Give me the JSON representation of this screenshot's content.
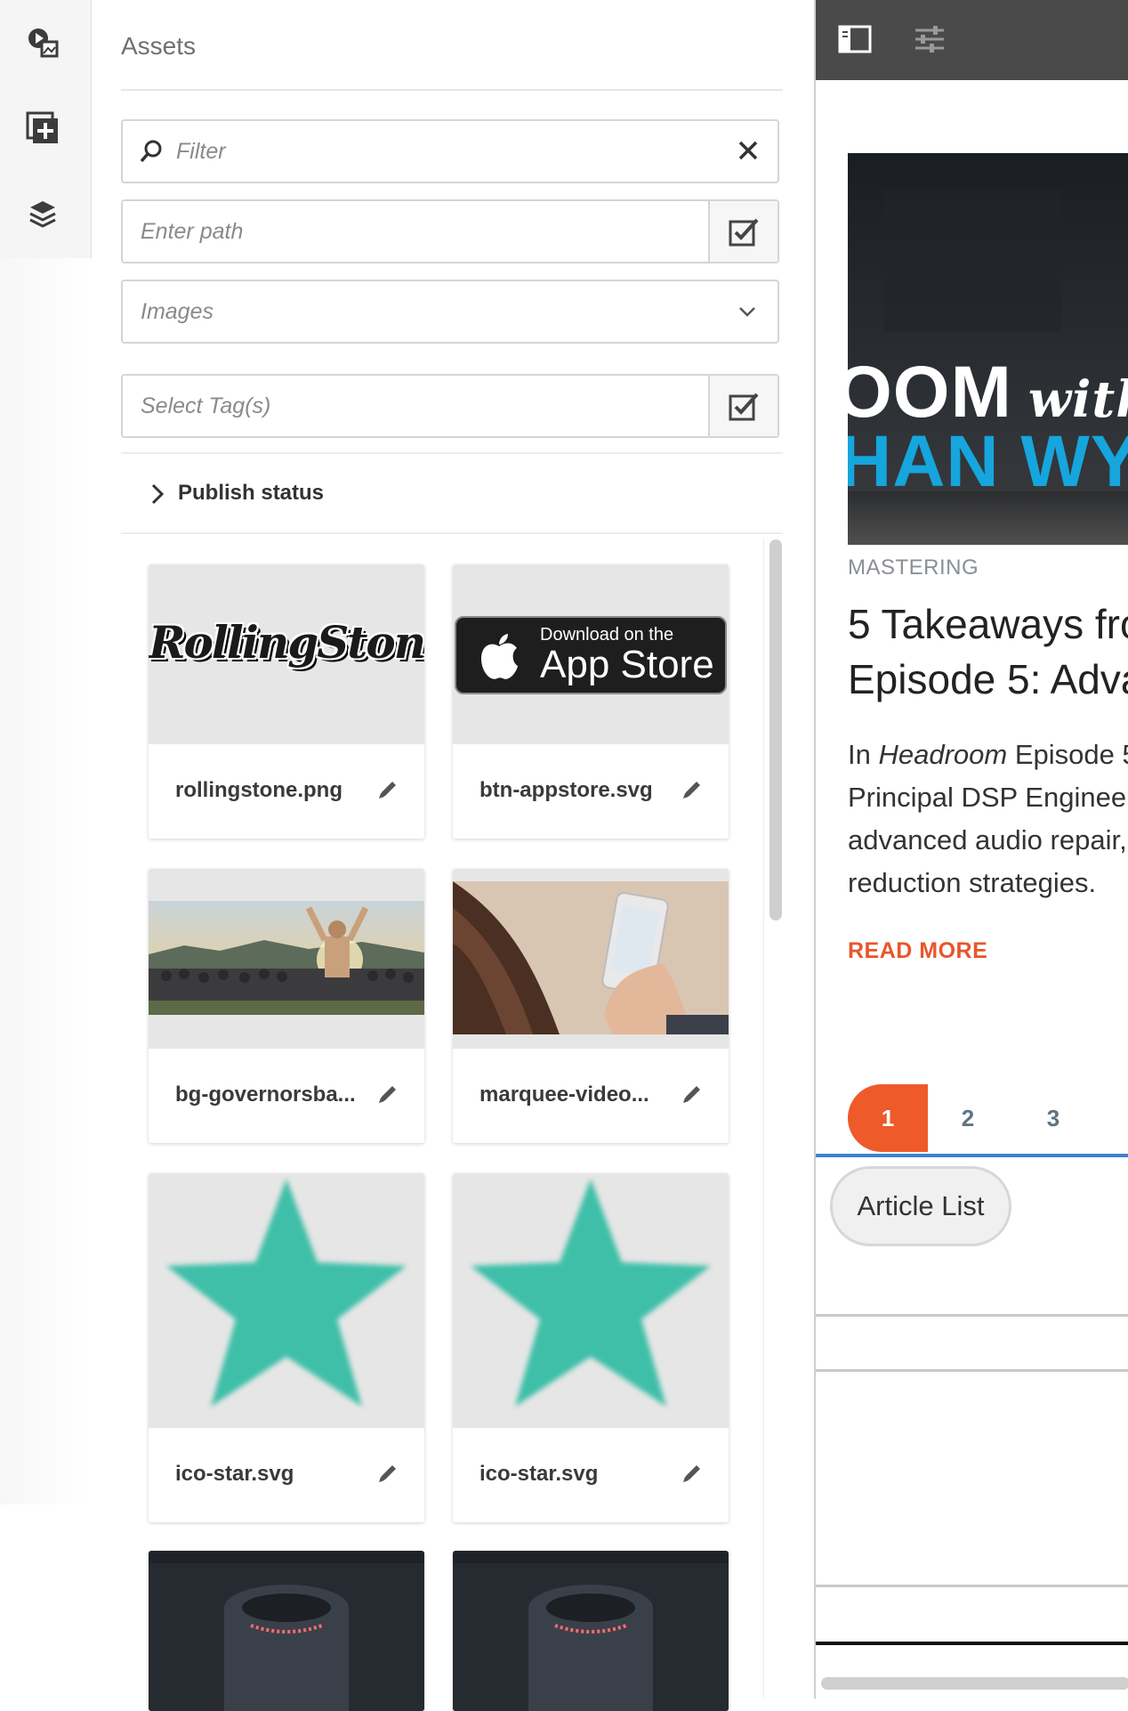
{
  "rail": {
    "icons": [
      "asset-finder-icon",
      "add-component-icon",
      "content-tree-icon"
    ]
  },
  "assets_panel": {
    "title": "Assets",
    "filter": {
      "placeholder": "Filter"
    },
    "path": {
      "placeholder": "Enter path"
    },
    "type_select": {
      "value": "Images"
    },
    "tags": {
      "placeholder": "Select Tag(s)"
    },
    "publish_status": {
      "label": "Publish status"
    },
    "cards": [
      {
        "name": "rollingstone.png",
        "thumb_text": "RollingStone"
      },
      {
        "name": "btn-appstore.svg",
        "thumb_small": "Download on the",
        "thumb_big": "App Store"
      },
      {
        "name": "bg-governorsba..."
      },
      {
        "name": "marquee-video..."
      },
      {
        "name": "ico-star.svg"
      },
      {
        "name": "ico-star.svg"
      },
      {
        "name": ""
      },
      {
        "name": ""
      }
    ],
    "star_color": "#3fbfa8"
  },
  "preview": {
    "toolbar_icons": [
      "side-panel-toggle-icon",
      "properties-sliders-icon"
    ],
    "hero": {
      "line1": "OOM",
      "line1_script": "with",
      "line2": "HAN WY"
    },
    "category": "MASTERING",
    "headline": [
      "5 Takeaways fro",
      "Episode 5: Adva"
    ],
    "body": [
      {
        "pre": "In ",
        "em": "Headroom",
        "post": " Episode 5"
      },
      {
        "pre": "Principal DSP Engineer"
      },
      {
        "pre": "advanced audio repair,"
      },
      {
        "pre": "reduction strategies."
      }
    ],
    "read_more": "READ MORE",
    "pages": [
      "1",
      "2",
      "3"
    ],
    "chip": "Article List",
    "accent": "#ee5a2a",
    "link_blue": "#3d83cf"
  }
}
